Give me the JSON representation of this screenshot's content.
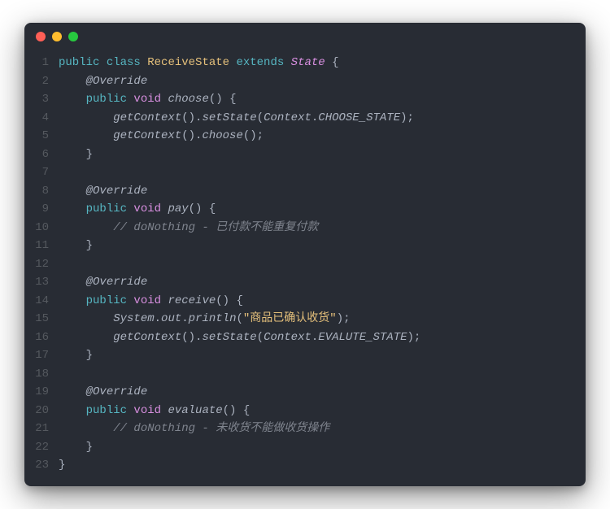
{
  "window": {
    "dots": [
      "red",
      "yellow",
      "green"
    ]
  },
  "code": {
    "lines": [
      {
        "n": 1,
        "indent": 0,
        "tokens": [
          {
            "t": "public ",
            "c": "tok-keyword"
          },
          {
            "t": "class ",
            "c": "tok-keyword"
          },
          {
            "t": "ReceiveState ",
            "c": "tok-type"
          },
          {
            "t": "extends ",
            "c": "tok-extends"
          },
          {
            "t": "State ",
            "c": "tok-super"
          },
          {
            "t": "{",
            "c": "punct"
          }
        ]
      },
      {
        "n": 2,
        "indent": 1,
        "tokens": [
          {
            "t": "@Override",
            "c": "tok-anno"
          }
        ]
      },
      {
        "n": 3,
        "indent": 1,
        "tokens": [
          {
            "t": "public ",
            "c": "tok-keyword"
          },
          {
            "t": "void ",
            "c": "tok-rettype"
          },
          {
            "t": "choose",
            "c": "tok-method"
          },
          {
            "t": "() {",
            "c": "punct"
          }
        ]
      },
      {
        "n": 4,
        "indent": 2,
        "tokens": [
          {
            "t": "getContext",
            "c": "tok-call"
          },
          {
            "t": "().",
            "c": "punct"
          },
          {
            "t": "setState",
            "c": "tok-call"
          },
          {
            "t": "(",
            "c": "punct"
          },
          {
            "t": "Context",
            "c": "tok-obj"
          },
          {
            "t": ".",
            "c": "punct"
          },
          {
            "t": "CHOOSE_STATE",
            "c": "tok-const"
          },
          {
            "t": ");",
            "c": "punct"
          }
        ]
      },
      {
        "n": 5,
        "indent": 2,
        "tokens": [
          {
            "t": "getContext",
            "c": "tok-call"
          },
          {
            "t": "().",
            "c": "punct"
          },
          {
            "t": "choose",
            "c": "tok-call"
          },
          {
            "t": "();",
            "c": "punct"
          }
        ]
      },
      {
        "n": 6,
        "indent": 1,
        "tokens": [
          {
            "t": "}",
            "c": "punct"
          }
        ]
      },
      {
        "n": 7,
        "indent": 0,
        "tokens": [
          {
            "t": "",
            "c": "punct"
          }
        ]
      },
      {
        "n": 8,
        "indent": 1,
        "tokens": [
          {
            "t": "@Override",
            "c": "tok-anno"
          }
        ]
      },
      {
        "n": 9,
        "indent": 1,
        "tokens": [
          {
            "t": "public ",
            "c": "tok-keyword"
          },
          {
            "t": "void ",
            "c": "tok-rettype"
          },
          {
            "t": "pay",
            "c": "tok-method"
          },
          {
            "t": "() {",
            "c": "punct"
          }
        ]
      },
      {
        "n": 10,
        "indent": 2,
        "tokens": [
          {
            "t": "// doNothing - 已付款不能重复付款",
            "c": "tok-comment"
          }
        ]
      },
      {
        "n": 11,
        "indent": 1,
        "tokens": [
          {
            "t": "}",
            "c": "punct"
          }
        ]
      },
      {
        "n": 12,
        "indent": 0,
        "tokens": [
          {
            "t": "",
            "c": "punct"
          }
        ]
      },
      {
        "n": 13,
        "indent": 1,
        "tokens": [
          {
            "t": "@Override",
            "c": "tok-anno"
          }
        ]
      },
      {
        "n": 14,
        "indent": 1,
        "tokens": [
          {
            "t": "public ",
            "c": "tok-keyword"
          },
          {
            "t": "void ",
            "c": "tok-rettype"
          },
          {
            "t": "receive",
            "c": "tok-method"
          },
          {
            "t": "() {",
            "c": "punct"
          }
        ]
      },
      {
        "n": 15,
        "indent": 2,
        "tokens": [
          {
            "t": "System",
            "c": "tok-obj"
          },
          {
            "t": ".",
            "c": "punct"
          },
          {
            "t": "out",
            "c": "tok-obj"
          },
          {
            "t": ".",
            "c": "punct"
          },
          {
            "t": "println",
            "c": "tok-call"
          },
          {
            "t": "(",
            "c": "punct"
          },
          {
            "t": "\"商品已确认收货\"",
            "c": "tok-string"
          },
          {
            "t": ");",
            "c": "punct"
          }
        ]
      },
      {
        "n": 16,
        "indent": 2,
        "tokens": [
          {
            "t": "getContext",
            "c": "tok-call"
          },
          {
            "t": "().",
            "c": "punct"
          },
          {
            "t": "setState",
            "c": "tok-call"
          },
          {
            "t": "(",
            "c": "punct"
          },
          {
            "t": "Context",
            "c": "tok-obj"
          },
          {
            "t": ".",
            "c": "punct"
          },
          {
            "t": "EVALUTE_STATE",
            "c": "tok-const"
          },
          {
            "t": ");",
            "c": "punct"
          }
        ]
      },
      {
        "n": 17,
        "indent": 1,
        "tokens": [
          {
            "t": "}",
            "c": "punct"
          }
        ]
      },
      {
        "n": 18,
        "indent": 0,
        "tokens": [
          {
            "t": "",
            "c": "punct"
          }
        ]
      },
      {
        "n": 19,
        "indent": 1,
        "tokens": [
          {
            "t": "@Override",
            "c": "tok-anno"
          }
        ]
      },
      {
        "n": 20,
        "indent": 1,
        "tokens": [
          {
            "t": "public ",
            "c": "tok-keyword"
          },
          {
            "t": "void ",
            "c": "tok-rettype"
          },
          {
            "t": "evaluate",
            "c": "tok-method"
          },
          {
            "t": "() {",
            "c": "punct"
          }
        ]
      },
      {
        "n": 21,
        "indent": 2,
        "tokens": [
          {
            "t": "// doNothing - 未收货不能做收货操作",
            "c": "tok-comment"
          }
        ]
      },
      {
        "n": 22,
        "indent": 1,
        "tokens": [
          {
            "t": "}",
            "c": "punct"
          }
        ]
      },
      {
        "n": 23,
        "indent": 0,
        "tokens": [
          {
            "t": "}",
            "c": "punct"
          }
        ]
      }
    ]
  }
}
